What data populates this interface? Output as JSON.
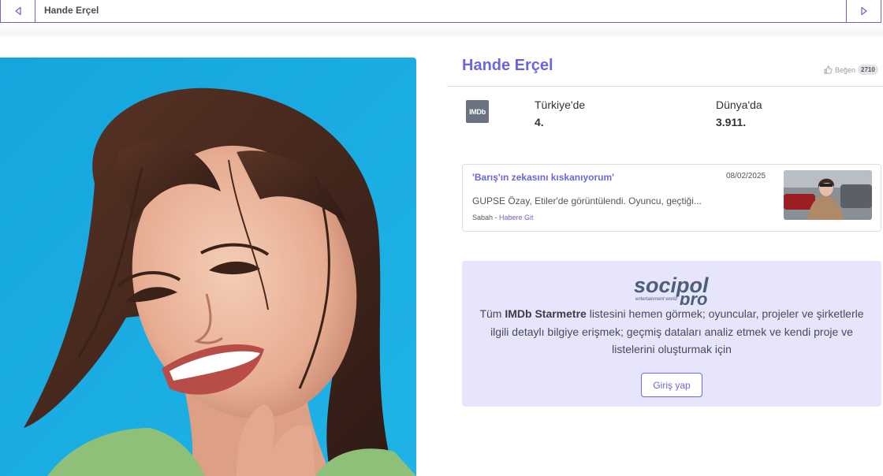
{
  "topbar": {
    "title": "Hande Erçel",
    "prev_icon": "triangle-left-icon",
    "next_icon": "triangle-right-icon"
  },
  "profile": {
    "name": "Hande Erçel",
    "like_label": "Beğen",
    "like_count": "2710",
    "like_icon": "thumbs-up-icon"
  },
  "rank": {
    "logo_text": "IMDb",
    "turkey_label": "Türkiye'de",
    "turkey_value": "4.",
    "world_label": "Dünya'da",
    "world_value": "3.911."
  },
  "news": {
    "title": "'Barış'ın zekasını kıskanıyorum'",
    "date": "08/02/2025",
    "excerpt": "GUPSE Özay, Etiler'de görüntülendi. Oyuncu, geçtiği...",
    "source": "Sabah",
    "separator": " - ",
    "link_label": "Habere Git"
  },
  "promo": {
    "logo_main": "socipol",
    "logo_sub": "pro",
    "logo_tagline": "entertainment world",
    "text_prefix": "Tüm ",
    "text_bold": "IMDb Starmetre",
    "text_suffix": " listesini hemen görmek; oyuncular, projeler ve şirketlerle ilgili detaylı bilgiye erişmek; geçmiş dataları analiz etmek ve kendi proje ve listelerini oluşturmak için",
    "login_label": "Giriş yap"
  },
  "colors": {
    "accent": "#6b66e0",
    "promo_bg": "#e6e5fb",
    "photo_bg": "#1aa8dd"
  }
}
